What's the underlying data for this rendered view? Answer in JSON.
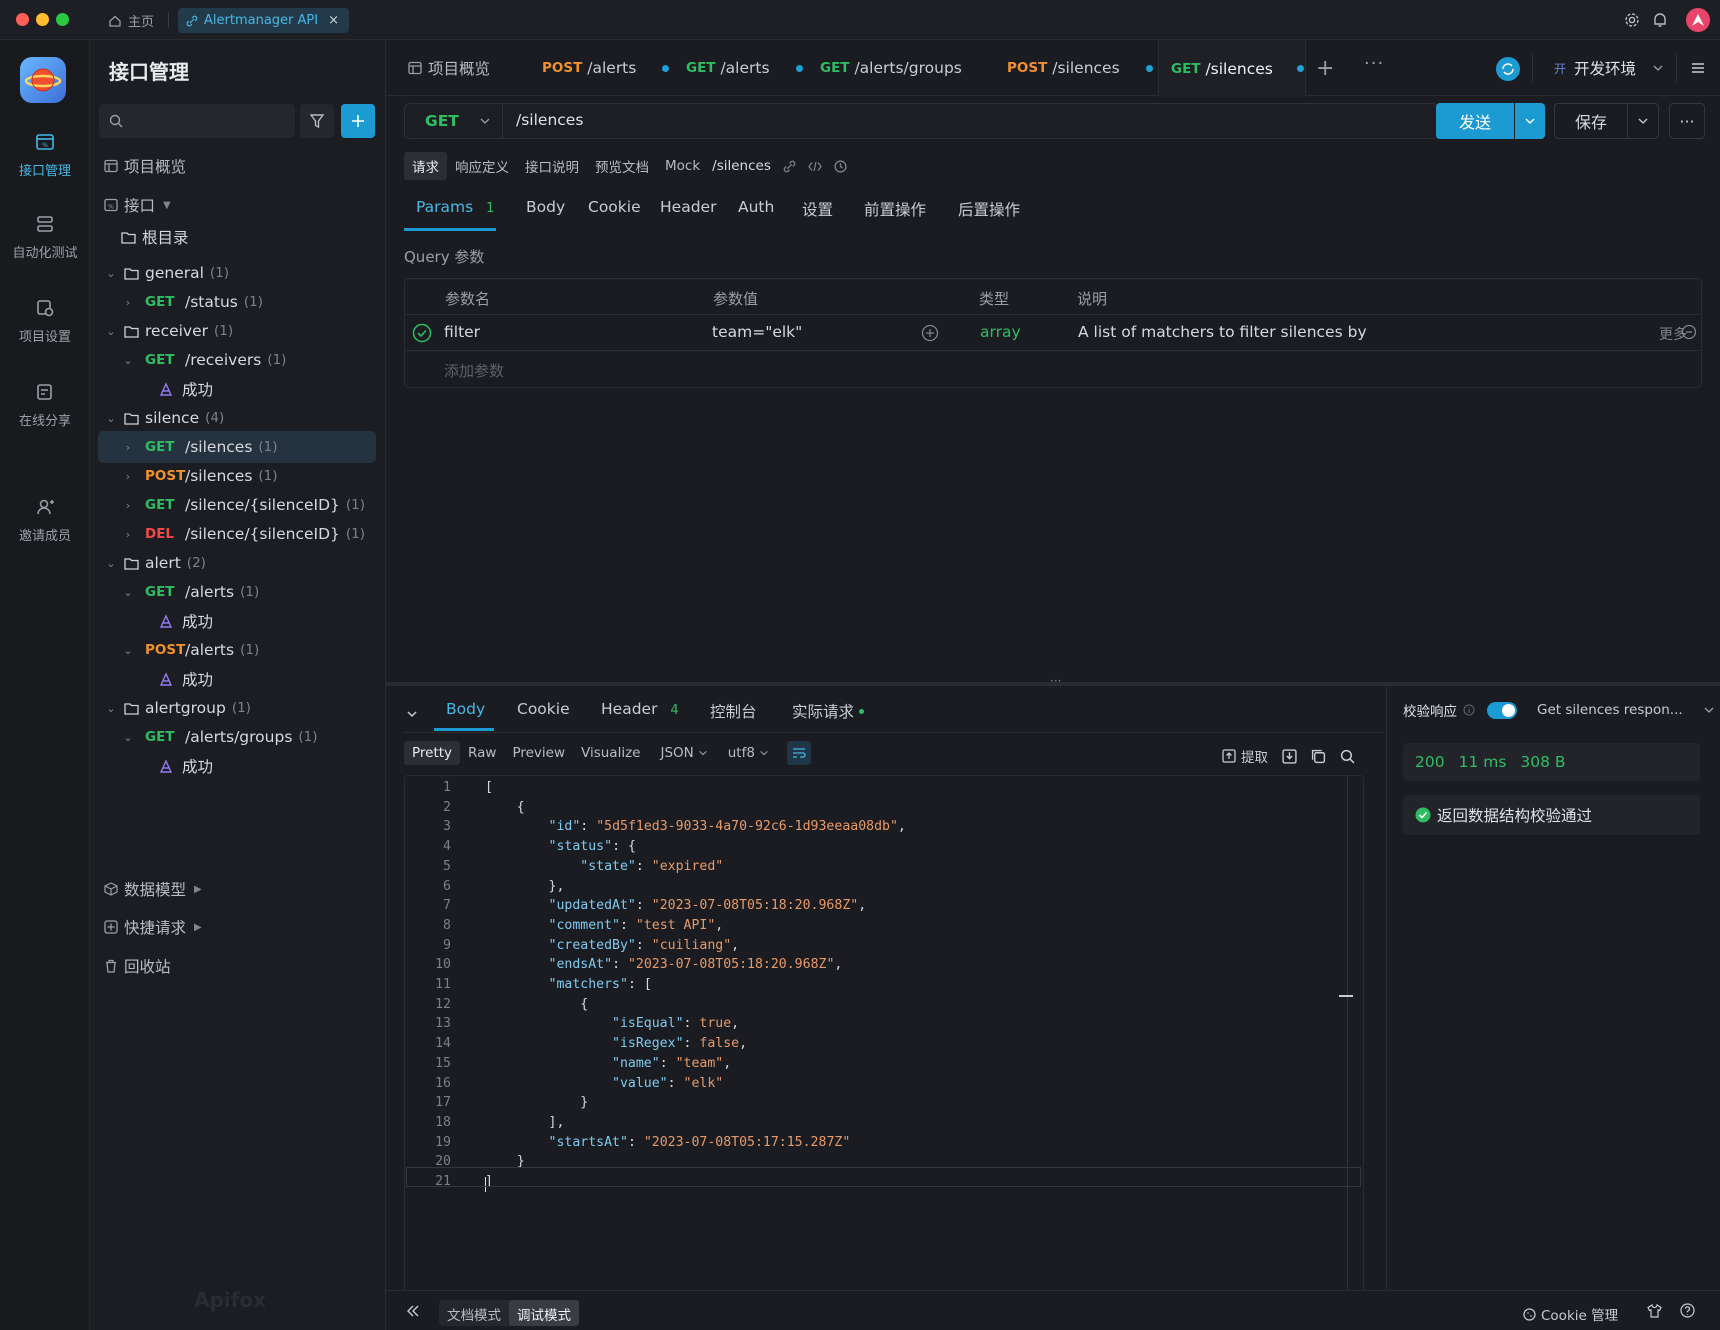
{
  "titlebar": {
    "home_label": "主页",
    "doc_tab_label": "Alertmanager API",
    "close_glyph": "×"
  },
  "rail": {
    "items": [
      {
        "label": "接口管理",
        "icon": "api-management-icon"
      },
      {
        "label": "自动化测试",
        "icon": "automation-test-icon"
      },
      {
        "label": "项目设置",
        "icon": "project-settings-icon"
      },
      {
        "label": "在线分享",
        "icon": "online-share-icon"
      },
      {
        "label": "邀请成员",
        "icon": "invite-member-icon"
      }
    ]
  },
  "tree": {
    "title": "接口管理",
    "search_placeholder": "",
    "overview_label": "项目概览",
    "api_section_label": "接口",
    "root_label": "根目录",
    "rows": [
      {
        "kind": "folder",
        "label": "general",
        "count": "(1)"
      },
      {
        "kind": "api",
        "method": "GET",
        "path": "/status",
        "count": "(1)"
      },
      {
        "kind": "folder",
        "label": "receiver",
        "count": "(1)"
      },
      {
        "kind": "api",
        "method": "GET",
        "path": "/receivers",
        "count": "(1)"
      },
      {
        "kind": "case",
        "label": "成功"
      },
      {
        "kind": "folder",
        "label": "silence",
        "count": "(4)"
      },
      {
        "kind": "api",
        "method": "GET",
        "path": "/silences",
        "count": "(1)"
      },
      {
        "kind": "api",
        "method": "POST",
        "path": "/silences",
        "count": "(1)"
      },
      {
        "kind": "api",
        "method": "GET",
        "path": "/silence/{silenceID}",
        "count": "(1)"
      },
      {
        "kind": "api",
        "method": "DEL",
        "path": "/silence/{silenceID}",
        "count": "(1)"
      },
      {
        "kind": "folder",
        "label": "alert",
        "count": "(2)"
      },
      {
        "kind": "api",
        "method": "GET",
        "path": "/alerts",
        "count": "(1)"
      },
      {
        "kind": "case",
        "label": "成功"
      },
      {
        "kind": "api",
        "method": "POST",
        "path": "/alerts",
        "count": "(1)"
      },
      {
        "kind": "case",
        "label": "成功"
      },
      {
        "kind": "folder",
        "label": "alertgroup",
        "count": "(1)"
      },
      {
        "kind": "api",
        "method": "GET",
        "path": "/alerts/groups",
        "count": "(1)"
      },
      {
        "kind": "case",
        "label": "成功"
      }
    ],
    "data_model_label": "数据模型",
    "quick_request_label": "快捷请求",
    "trash_label": "回收站",
    "watermark": "Apifox"
  },
  "request_tabs": [
    {
      "method": "",
      "path": "项目概览"
    },
    {
      "method": "POST",
      "path": "/alerts"
    },
    {
      "method": "GET",
      "path": "/alerts"
    },
    {
      "method": "GET",
      "path": "/alerts/groups"
    },
    {
      "method": "POST",
      "path": "/silences"
    },
    {
      "method": "GET",
      "path": "/silences"
    }
  ],
  "env": {
    "badge": "开",
    "label": "开发环境"
  },
  "urlbar": {
    "method": "GET",
    "url": "/silences",
    "send_label": "发送",
    "save_label": "保存"
  },
  "doc_tabs": [
    "请求",
    "响应定义",
    "接口说明",
    "预览文档",
    "Mock"
  ],
  "doc_path": "/silences",
  "param_tabs": {
    "params_label": "Params",
    "params_count": "1",
    "others": [
      "Body",
      "Cookie",
      "Header",
      "Auth",
      "设置",
      "前置操作",
      "后置操作"
    ]
  },
  "query": {
    "section_label": "Query 参数",
    "headers": [
      "参数名",
      "参数值",
      "类型",
      "说明"
    ],
    "rows": [
      {
        "name": "filter",
        "value": "team=\"elk\"",
        "type": "array",
        "description": "A list of matchers to filter silences by",
        "more_label": "更多"
      }
    ],
    "add_placeholder": "添加参数"
  },
  "response": {
    "tabs": [
      "Body",
      "Cookie",
      "Header",
      "控制台",
      "实际请求"
    ],
    "header_count": "4",
    "view_tabs": [
      "Pretty",
      "Raw",
      "Preview",
      "Visualize"
    ],
    "format": "JSON",
    "encoding": "utf8",
    "extract_label": "提取",
    "code_lines": [
      "[",
      "    {",
      "        \"id\": \"5d5f1ed3-9033-4a70-92c6-1d93eeaa08db\",",
      "        \"status\": {",
      "            \"state\": \"expired\"",
      "        },",
      "        \"updatedAt\": \"2023-07-08T05:18:20.968Z\",",
      "        \"comment\": \"test API\",",
      "        \"createdBy\": \"cuiliang\",",
      "        \"endsAt\": \"2023-07-08T05:18:20.968Z\",",
      "        \"matchers\": [",
      "            {",
      "                \"isEqual\": true,",
      "                \"isRegex\": false,",
      "                \"name\": \"team\",",
      "                \"value\": \"elk\"",
      "            }",
      "        ],",
      "        \"startsAt\": \"2023-07-08T05:17:15.287Z\"",
      "    }",
      "]"
    ]
  },
  "validation": {
    "label": "校验响应",
    "schema_select": "Get silences respon...",
    "status": "200",
    "time": "11 ms",
    "size": "308 B",
    "result": "返回数据结构校验通过"
  },
  "footer": {
    "doc_mode": "文档模式",
    "debug_mode": "调试模式",
    "cookie_label": "Cookie 管理"
  },
  "colors": {
    "accent": "#1b9bd1",
    "get": "#2fbd64",
    "post": "#f0912f",
    "del": "#ee4a48"
  }
}
